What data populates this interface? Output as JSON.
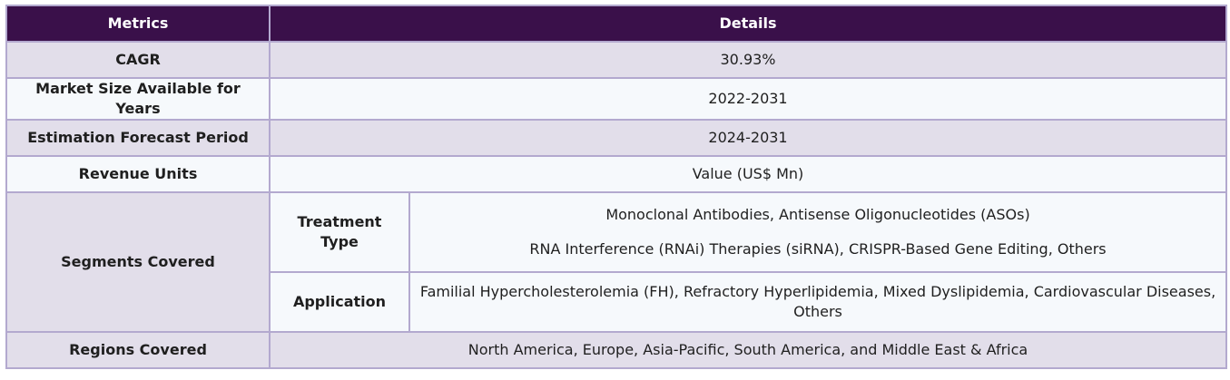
{
  "table": {
    "headers": {
      "metrics": "Metrics",
      "details": "Details"
    },
    "rows": {
      "cagr": {
        "label": "CAGR",
        "value": "30.93%"
      },
      "market_size": {
        "label": "Market Size Available for Years",
        "value": "2022-2031"
      },
      "forecast": {
        "label": "Estimation Forecast Period",
        "value": "2024-2031"
      },
      "revenue_units": {
        "label": "Revenue Units",
        "value": "Value (US$ Mn)"
      },
      "segments": {
        "label": "Segments Covered",
        "treatment_type": {
          "label_line1": "Treatment",
          "label_line2": "Type",
          "line1": "Monoclonal Antibodies, Antisense Oligonucleotides (ASOs)",
          "line2": "RNA Interference (RNAi) Therapies (siRNA), CRISPR-Based Gene Editing, Others"
        },
        "application": {
          "label": "Application",
          "value": "Familial Hypercholesterolemia (FH), Refractory Hyperlipidemia, Mixed Dyslipidemia, Cardiovascular Diseases, Others"
        }
      },
      "regions": {
        "label": "Regions Covered",
        "value": "North America, Europe, Asia-Pacific, South America, and Middle East & Africa"
      }
    }
  },
  "colors": {
    "header_bg": "#3a104a",
    "header_text": "#ffffff",
    "row_shade": "#e2deea",
    "row_light": "#f6f9fc",
    "border": "#b3a9cf"
  }
}
